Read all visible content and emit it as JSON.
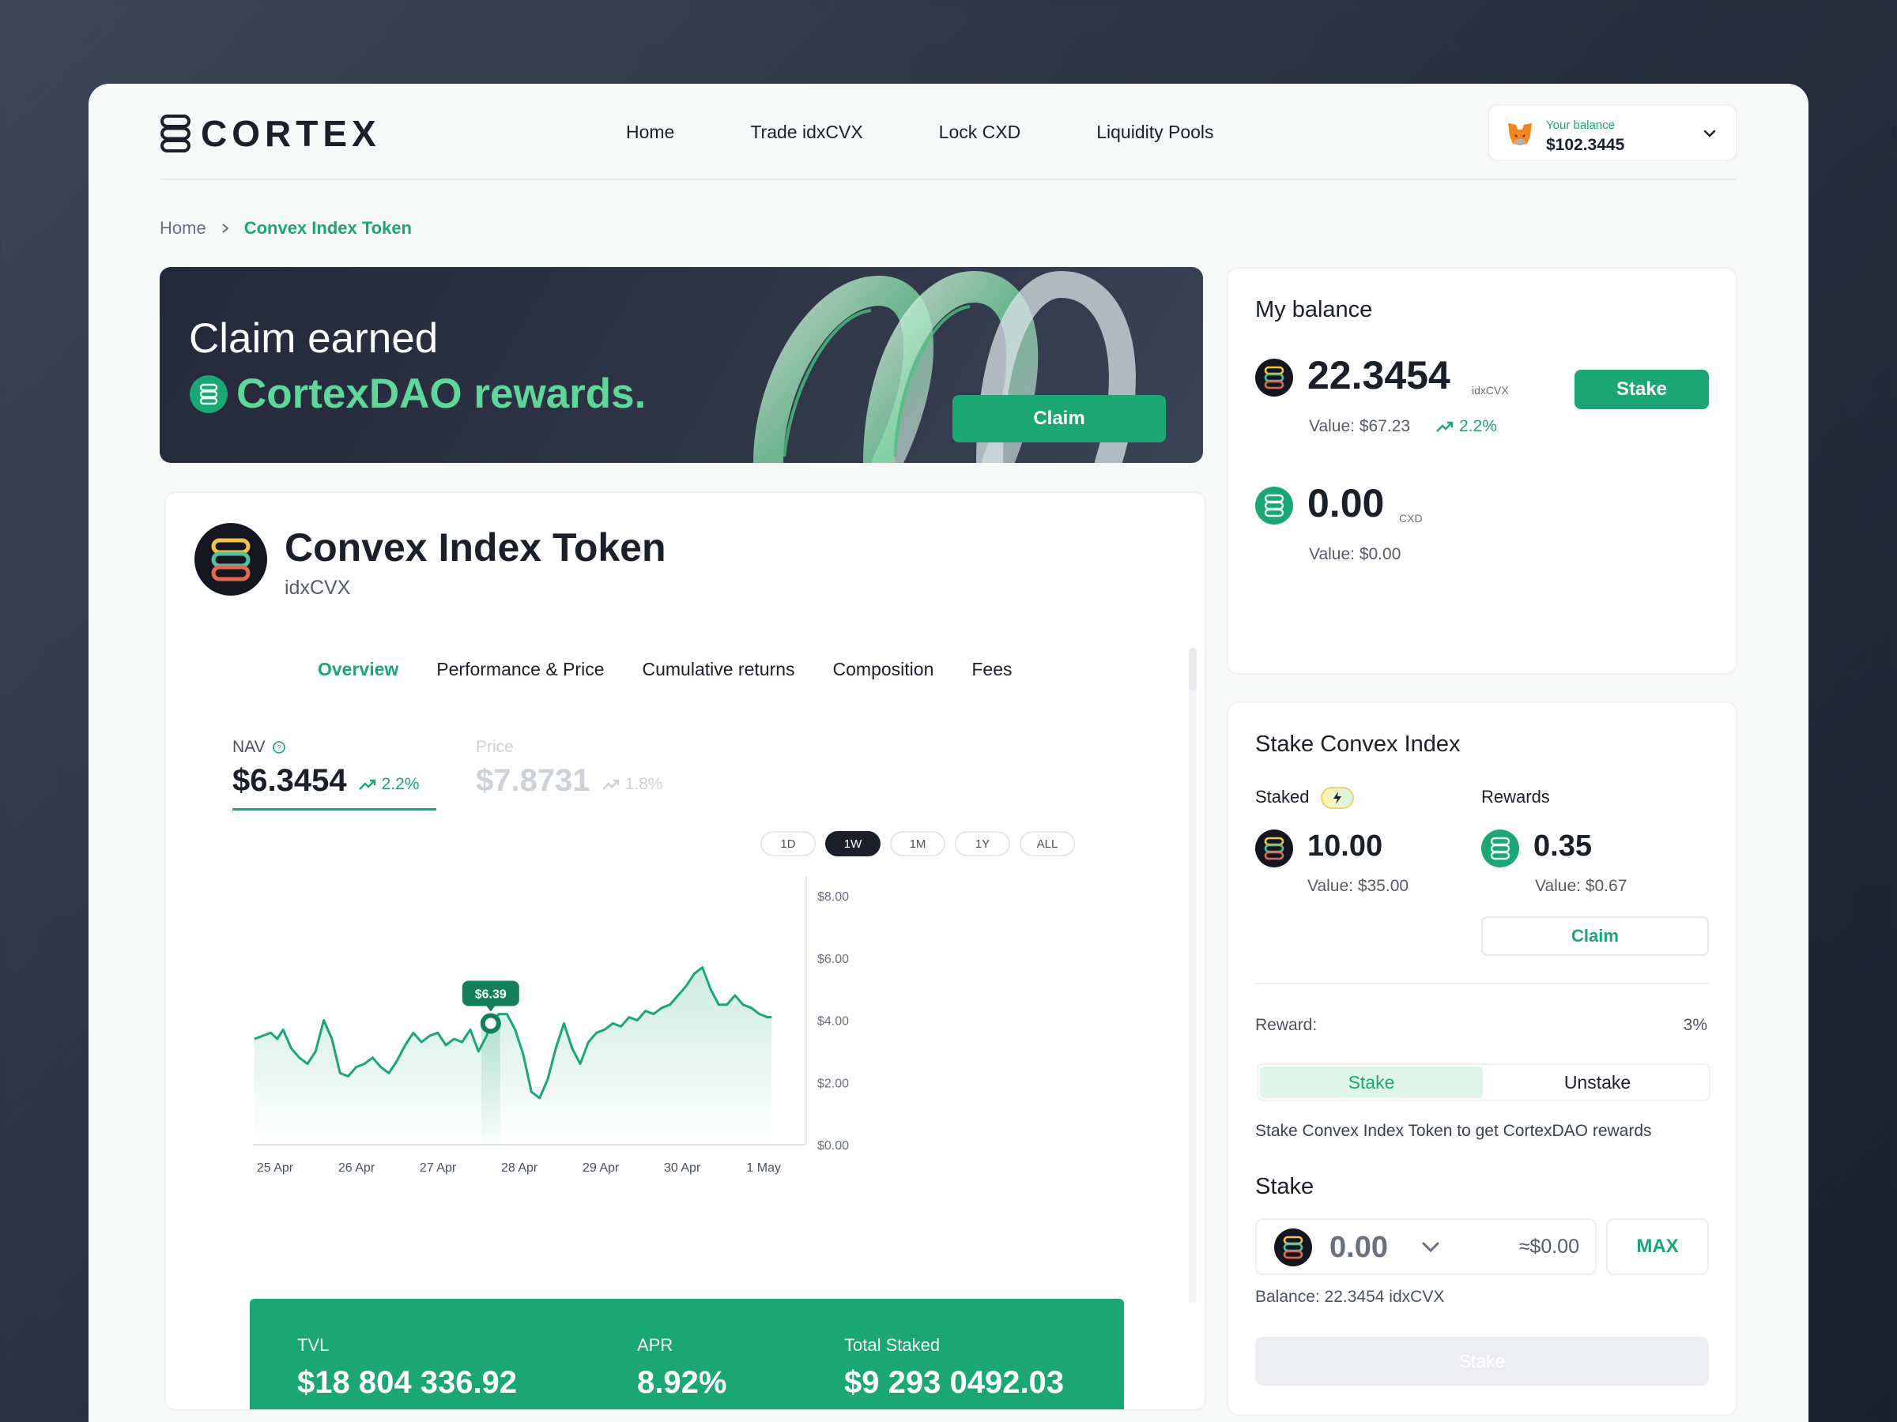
{
  "brand": {
    "name": "CORTEX"
  },
  "nav": {
    "items": [
      "Home",
      "Trade idxCVX",
      "Lock CXD",
      "Liquidity Pools"
    ]
  },
  "wallet": {
    "label": "Your balance",
    "value": "$102.3445"
  },
  "breadcrumb": {
    "home": "Home",
    "current": "Convex Index Token"
  },
  "banner": {
    "line1": "Claim earned",
    "line2": "CortexDAO rewards.",
    "claim_label": "Claim"
  },
  "token": {
    "name": "Convex Index Token",
    "symbol": "idxCVX"
  },
  "tabs": [
    "Overview",
    "Performance & Price",
    "Cumulative returns",
    "Composition",
    "Fees"
  ],
  "active_tab": "Overview",
  "metrics": {
    "nav": {
      "label": "NAV",
      "value": "$6.3454",
      "change": "2.2%"
    },
    "price": {
      "label": "Price",
      "value": "$7.8731",
      "change": "1.8%"
    }
  },
  "ranges": [
    "1D",
    "1W",
    "1M",
    "1Y",
    "ALL"
  ],
  "active_range": "1W",
  "chart_data": {
    "type": "area",
    "x_ticks": [
      "25 Apr",
      "26 Apr",
      "27 Apr",
      "28 Apr",
      "29 Apr",
      "30 Apr",
      "1 May"
    ],
    "y_ticks": [
      "$8.00",
      "$6.00",
      "$4.00",
      "$2.00",
      "$0.00"
    ],
    "ylim": [
      0,
      8
    ],
    "xlim": [
      0,
      6.6
    ],
    "tooltip": {
      "label": "$6.39",
      "x": 2.9,
      "y": 3.9
    },
    "x": [
      0,
      0.1,
      0.2,
      0.28,
      0.35,
      0.45,
      0.55,
      0.65,
      0.75,
      0.85,
      0.95,
      1.05,
      1.15,
      1.25,
      1.35,
      1.45,
      1.55,
      1.65,
      1.75,
      1.85,
      1.95,
      2.05,
      2.15,
      2.25,
      2.35,
      2.45,
      2.55,
      2.65,
      2.75,
      2.85,
      2.9,
      3.0,
      3.1,
      3.2,
      3.3,
      3.4,
      3.5,
      3.6,
      3.7,
      3.8,
      3.9,
      4.0,
      4.1,
      4.2,
      4.3,
      4.4,
      4.5,
      4.6,
      4.7,
      4.8,
      4.9,
      5.0,
      5.1,
      5.2,
      5.3,
      5.4,
      5.5,
      5.6,
      5.7,
      5.8,
      5.9,
      6.0,
      6.1,
      6.2,
      6.3,
      6.35
    ],
    "y": [
      3.4,
      3.5,
      3.6,
      3.4,
      3.7,
      3.1,
      2.8,
      2.6,
      3.0,
      4.0,
      3.4,
      2.3,
      2.2,
      2.5,
      2.6,
      2.8,
      2.5,
      2.3,
      2.7,
      3.2,
      3.6,
      3.3,
      3.5,
      3.6,
      3.2,
      3.4,
      3.3,
      3.7,
      3.0,
      3.5,
      3.9,
      4.2,
      4.2,
      3.7,
      2.9,
      1.7,
      1.5,
      2.1,
      3.1,
      3.9,
      3.1,
      2.6,
      3.3,
      3.6,
      3.7,
      3.9,
      3.8,
      4.1,
      4.0,
      4.3,
      4.2,
      4.4,
      4.5,
      4.8,
      5.1,
      5.5,
      5.7,
      5.0,
      4.5,
      4.5,
      4.8,
      4.5,
      4.4,
      4.2,
      4.1,
      4.1
    ]
  },
  "stats": {
    "tvl": {
      "label": "TVL",
      "value": "$18 804 336.92"
    },
    "apr": {
      "label": "APR",
      "value": "8.92%"
    },
    "total_staked": {
      "label": "Total Staked",
      "value": "$9 293 0492.03"
    }
  },
  "balance_card": {
    "title": "My balance",
    "idx": {
      "amount": "22.3454",
      "unit": "idxCVX",
      "value": "Value: $67.23",
      "change": "2.2%"
    },
    "cxd": {
      "amount": "0.00",
      "unit": "CXD",
      "value": "Value: $0.00"
    },
    "stake_label": "Stake"
  },
  "stake_card": {
    "title": "Stake Convex Index",
    "staked_label": "Staked",
    "rewards_label": "Rewards",
    "staked": {
      "amount": "10.00",
      "value": "Value: $35.00"
    },
    "rewards": {
      "amount": "0.35",
      "value": "Value: $0.67"
    },
    "claim_label": "Claim",
    "reward_label": "Reward:",
    "reward_value": "3%",
    "toggle": [
      "Stake",
      "Unstake"
    ],
    "description": "Stake Convex Index Token to get CortexDAO rewards",
    "section_title": "Stake",
    "input": {
      "amount": "0.00",
      "usd": "≈$0.00"
    },
    "max_label": "MAX",
    "balance_line": "Balance: 22.3454 idxCVX",
    "submit_label": "Stake"
  },
  "colors": {
    "accent": "#1ba774",
    "dark": "#1b1f2a"
  }
}
